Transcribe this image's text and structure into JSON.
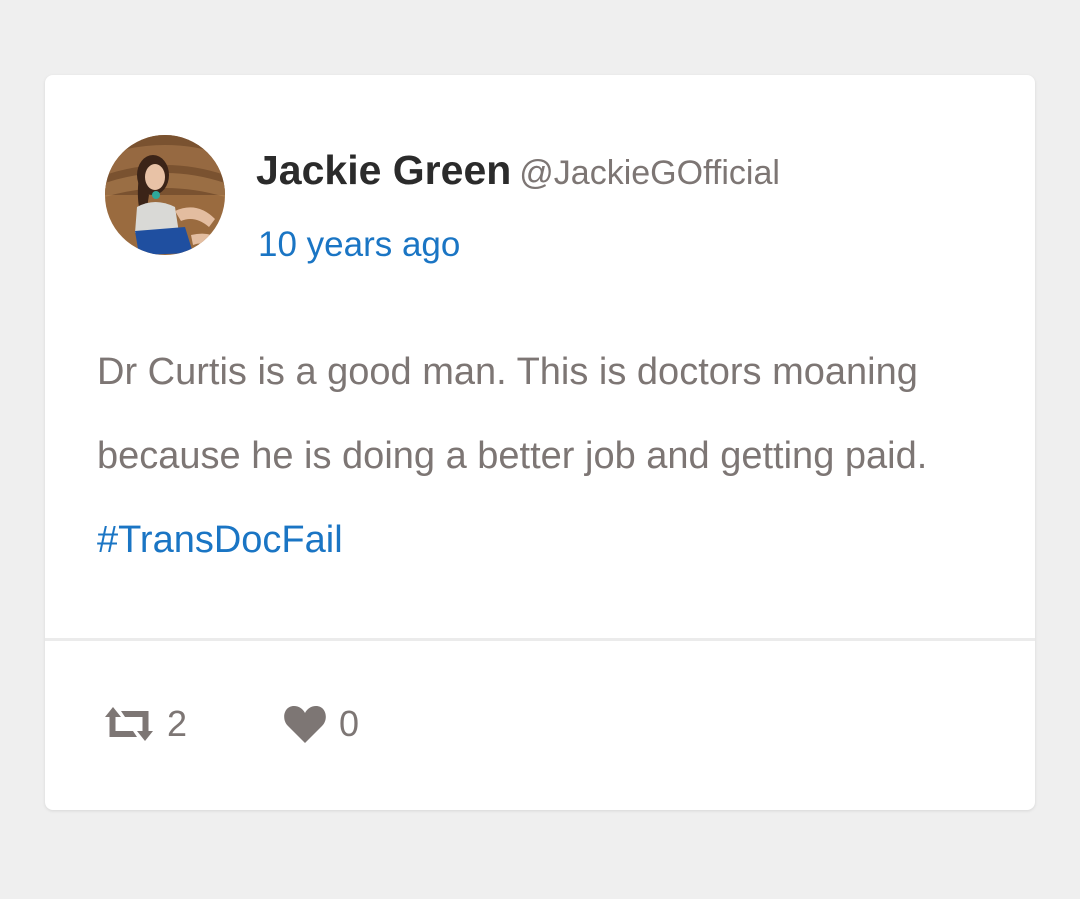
{
  "post": {
    "author_name": "Jackie Green",
    "author_handle": "@JackieGOfficial",
    "timestamp": "10 years ago",
    "text": "Dr Curtis is a good man. This is doctors moaning because he is doing a better job and getting paid.",
    "hashtag": "#TransDocFail",
    "retweet_count": "2",
    "like_count": "0"
  },
  "icons": {
    "retweet": "retweet-icon",
    "like": "heart-icon"
  },
  "colors": {
    "background": "#efefef",
    "card": "#ffffff",
    "author": "#2b2b2b",
    "muted": "#7d7674",
    "link": "#1a75c4"
  }
}
